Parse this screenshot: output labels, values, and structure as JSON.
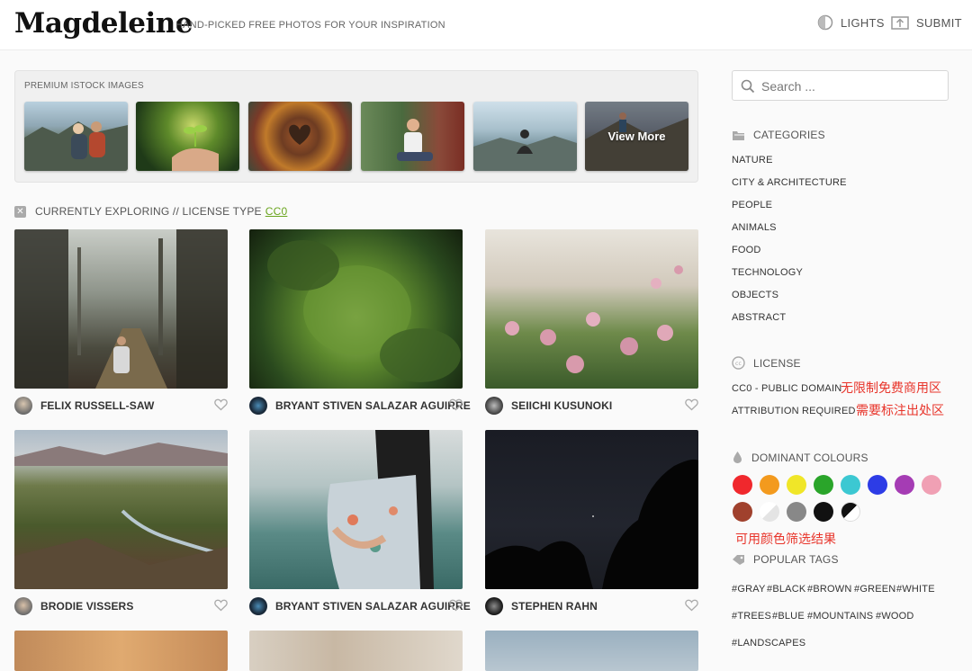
{
  "header": {
    "logo": "Magdeleine",
    "tagline": "HAND-PICKED FREE PHOTOS FOR YOUR INSPIRATION",
    "lights_label": "LIGHTS",
    "submit_label": "SUBMIT"
  },
  "premium": {
    "title": "PREMIUM ISTOCK IMAGES",
    "view_more": "View More"
  },
  "exploring": {
    "prefix": "CURRENTLY EXPLORING // LICENSE TYPE",
    "license": "CC0"
  },
  "photos": [
    {
      "author": "FELIX RUSSELL-SAW"
    },
    {
      "author": "BRYANT STIVEN SALAZAR AGUIRRE"
    },
    {
      "author": "SEIICHI KUSUNOKI"
    },
    {
      "author": "BRODIE VISSERS"
    },
    {
      "author": "BRYANT STIVEN SALAZAR AGUIRRE"
    },
    {
      "author": "STEPHEN RAHN"
    }
  ],
  "search": {
    "placeholder": "Search ..."
  },
  "categories": {
    "title": "CATEGORIES",
    "items": [
      "NATURE",
      "CITY & ARCHITECTURE",
      "PEOPLE",
      "ANIMALS",
      "FOOD",
      "TECHNOLOGY",
      "OBJECTS",
      "ABSTRACT"
    ]
  },
  "license": {
    "title": "LICENSE",
    "items": [
      "CC0 - PUBLIC DOMAIN",
      "ATTRIBUTION REQUIRED"
    ]
  },
  "annotations": {
    "cc0_note": "无限制免费商用区",
    "attribution_note": "需要标注出处区",
    "colours_note": "可用颜色筛选结果"
  },
  "colours": {
    "title": "DOMINANT COLOURS",
    "swatches": [
      "#f0282d",
      "#f39a1e",
      "#f0e628",
      "#2aa52a",
      "#3cc8d2",
      "#2d3ce6",
      "#a53cb4",
      "#f0a0b4",
      "#a0412d",
      "#f0f0f0",
      "#888888",
      "#111111",
      "#bw-split"
    ]
  },
  "tags": {
    "title": "POPULAR TAGS",
    "items": [
      "#GRAY",
      "#BLACK",
      "#BROWN",
      "#GREEN",
      "#WHITE",
      "#TREES",
      "#BLUE",
      "#MOUNTAINS",
      "#WOOD",
      "#LANDSCAPES"
    ]
  }
}
